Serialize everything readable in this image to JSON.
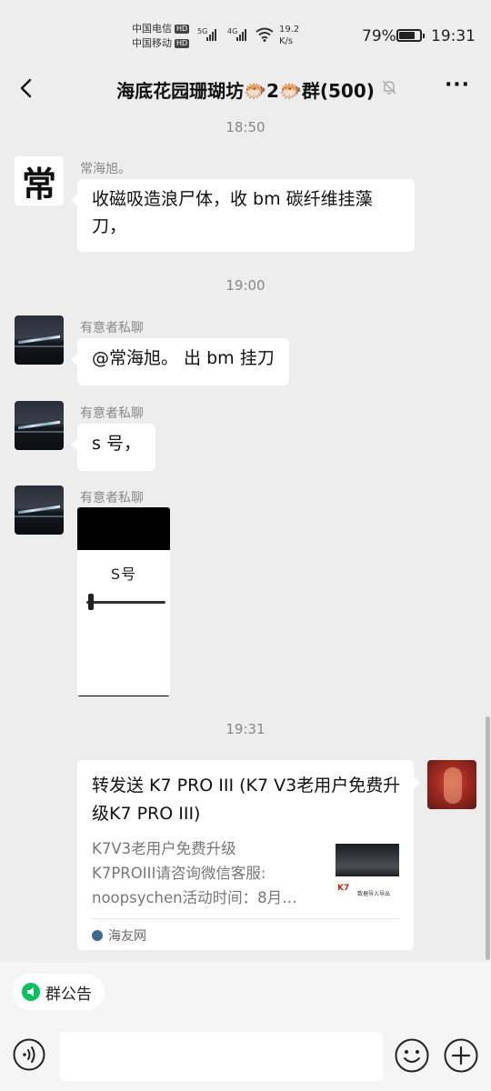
{
  "status_bar": {
    "carrier1": "中国电信",
    "carrier2": "中国移动",
    "hd": "HD",
    "net1": "5G",
    "net2": "4G",
    "speed_value": "19.2",
    "speed_unit": "K/s",
    "battery_pct": "79%",
    "battery_level": 0.79,
    "time": "19:31"
  },
  "header": {
    "title": "海底花园珊瑚坊🐡2🐡群(500)",
    "back_icon": "chevron-left-icon",
    "mute_icon": "bell-off-icon",
    "more_label": "···"
  },
  "messages": {
    "ts1": "18:50",
    "m1": {
      "sender": "常海旭。",
      "avatar_char": "常",
      "text": "收磁吸造浪尸体，收 bm 碳纤维挂藻刀，"
    },
    "ts2": "19:00",
    "m2": {
      "sender": "有意者私聊",
      "text": "@常海旭。 出 bm 挂刀"
    },
    "m3": {
      "sender": "有意者私聊",
      "text": "s 号，"
    },
    "m4": {
      "sender": "有意者私聊",
      "image_caption": "S号"
    },
    "ts3": "19:31",
    "card": {
      "title": "转发送 K7 PRO III (K7 V3老用户免费升级K7 PRO III)",
      "desc": "K7V3老用户免费升级\nK7PROIII请咨询微信客服:\nnoopsychen活动时间：8月…",
      "thumb_brand": "K7",
      "thumb_text": "数据导入导出",
      "source": "海友网"
    }
  },
  "notice": {
    "label": "群公告"
  },
  "input_bar": {
    "voice_icon": "voice-icon",
    "emoji_icon": "emoji-icon",
    "plus_icon": "plus-icon"
  },
  "colors": {
    "accent": "#07c160",
    "background": "#ededed",
    "bubble": "#ffffff"
  }
}
